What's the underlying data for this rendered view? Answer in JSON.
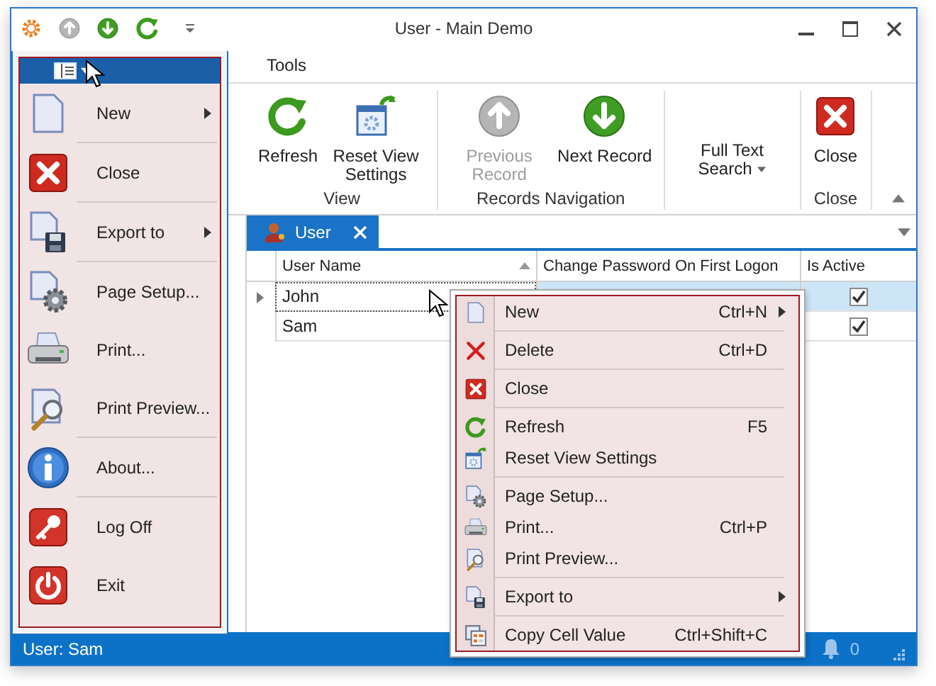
{
  "window": {
    "title": "User - Main Demo"
  },
  "quick_access": [
    {
      "disabled": false
    },
    {
      "disabled": true
    },
    {
      "disabled": false
    },
    {
      "disabled": false
    }
  ],
  "ribbon": {
    "tabs": [
      {
        "label": "Tools"
      }
    ],
    "groups": [
      {
        "label": "View",
        "buttons": [
          {
            "label": "Refresh",
            "disabled": false
          },
          {
            "label": "Reset View Settings",
            "disabled": false
          }
        ]
      },
      {
        "label": "Records Navigation",
        "buttons": [
          {
            "label": "Previous Record",
            "disabled": true
          },
          {
            "label": "Next Record",
            "disabled": false
          }
        ]
      },
      {
        "buttons": [
          {
            "label": "Full Text Search",
            "disabled": false,
            "dropdown": true
          }
        ]
      },
      {
        "label": "Close",
        "buttons": [
          {
            "label": "Close",
            "disabled": false
          }
        ]
      }
    ]
  },
  "document_tabs": [
    {
      "label": "User",
      "selected": true
    }
  ],
  "grid": {
    "columns": [
      {
        "label": "User Name",
        "sorted": true
      },
      {
        "label": "Change Password On First Logon",
        "sorted": false
      },
      {
        "label": "Is Active",
        "sorted": false
      }
    ],
    "rows": [
      {
        "user_name": "John",
        "is_active": true,
        "selected": true
      },
      {
        "user_name": "Sam",
        "is_active": true,
        "selected": false
      }
    ]
  },
  "status_bar": {
    "text": "User: Sam",
    "notifications": "0"
  },
  "app_menu": {
    "groups": [
      [
        {
          "label": "New",
          "submenu": true
        }
      ],
      [
        {
          "label": "Close",
          "submenu": false
        }
      ],
      [
        {
          "label": "Export to",
          "submenu": true
        }
      ],
      [
        {
          "label": "Page Setup...",
          "submenu": false
        },
        {
          "label": "Print...",
          "submenu": false
        },
        {
          "label": "Print Preview...",
          "submenu": false
        }
      ],
      [
        {
          "label": "About...",
          "submenu": false
        }
      ],
      [
        {
          "label": "Log Off",
          "submenu": false
        },
        {
          "label": "Exit",
          "submenu": false
        }
      ]
    ]
  },
  "context_menu": {
    "groups": [
      [
        {
          "label": "New",
          "shortcut": "Ctrl+N",
          "submenu": true
        }
      ],
      [
        {
          "label": "Delete",
          "shortcut": "Ctrl+D",
          "submenu": false
        }
      ],
      [
        {
          "label": "Close",
          "submenu": false
        }
      ],
      [
        {
          "label": "Refresh",
          "shortcut": "F5",
          "submenu": false
        },
        {
          "label": "Reset View Settings",
          "submenu": false
        }
      ],
      [
        {
          "label": "Page Setup...",
          "submenu": false
        },
        {
          "label": "Print...",
          "shortcut": "Ctrl+P",
          "submenu": false
        },
        {
          "label": "Print Preview...",
          "submenu": false
        }
      ],
      [
        {
          "label": "Export to",
          "submenu": true
        }
      ],
      [
        {
          "label": "Copy Cell Value",
          "shortcut": "Ctrl+Shift+C",
          "submenu": false
        }
      ]
    ]
  }
}
